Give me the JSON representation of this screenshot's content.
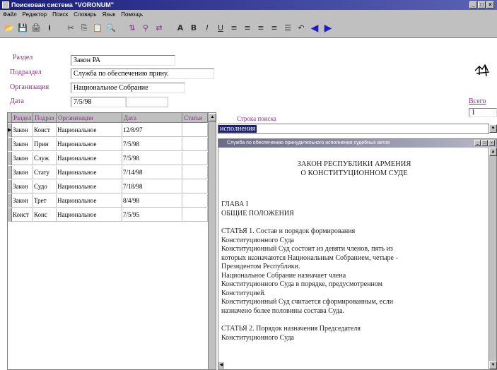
{
  "window": {
    "title": "Поисковая система \"VORONUM\"",
    "controls": [
      "_",
      "□",
      "×"
    ]
  },
  "menu": [
    "Файл",
    "Редактор",
    "Поиск",
    "Словарь",
    "Язык",
    "Помощь"
  ],
  "toolbar": {
    "icons": [
      "open-icon",
      "save-icon",
      "print-icon",
      "info-icon",
      "cut-icon",
      "copy-icon",
      "paste-icon",
      "find-icon",
      "sort-icon",
      "filter-icon",
      "replace-icon",
      "bold-icon",
      "italic-icon",
      "underline-icon",
      "align-left-icon",
      "align-center-icon",
      "align-right-icon",
      "justify-icon",
      "list-icon",
      "undo-icon",
      "prev-icon",
      "next-icon"
    ],
    "glyphs": [
      "📂",
      "💾",
      "🖨",
      "i",
      "✂",
      "⎘",
      "📋",
      "🔍",
      "⇅",
      "⚲",
      "⇄",
      "A",
      "B",
      "I",
      "U",
      "≡",
      "≡",
      "≡",
      "≡",
      "☰",
      "↶",
      "◀",
      "▶"
    ]
  },
  "form": {
    "razdel_label": "Раздел",
    "razdel_value": "Закон РА",
    "podrazdel_label": "Подраздел",
    "podrazdel_value": "Служба по обеспечению прину.",
    "org_label": "Организация",
    "org_value": "Национальное Собрание",
    "date_label": "Дата",
    "date_value": "7/5/98",
    "search_label": "Строка поиска",
    "search_value": "исполнения",
    "total_label": "Всего",
    "total_value": "1"
  },
  "grid": {
    "columns": [
      "Раздел",
      "Подраз",
      "Организация",
      "Дата",
      "Статья"
    ],
    "rows": [
      [
        "Закон",
        "Конст",
        "Национальное",
        "12/8/97",
        ""
      ],
      [
        "Закон",
        "Прин",
        "Национальное",
        "7/5/98",
        ""
      ],
      [
        "Закон",
        "Служ",
        "Национальное",
        "7/5/98",
        ""
      ],
      [
        "Закон",
        "Стату",
        "Национальное",
        "7/14/98",
        ""
      ],
      [
        "Закон",
        "Судо",
        "Национальное",
        "7/18/98",
        ""
      ],
      [
        "Закон",
        "Трет",
        "Национальное",
        "8/4/98",
        ""
      ],
      [
        "Конст",
        "Конс",
        "Национальное",
        "7/5/95",
        ""
      ]
    ]
  },
  "document": {
    "title": "Служба по обеспечению принудительного исполнения судебных актов",
    "heading1": "ЗАКОН РЕСПУБЛИКИ АРМЕНИЯ",
    "heading2": "О КОНСТИТУЦИОННОМ СУДЕ",
    "chapter": "ГЛАВА I",
    "chapter_title": "ОБЩИЕ ПОЛОЖЕНИЯ",
    "article1_title": "СТАТЬЯ 1. Состав и порядок формирования",
    "article1_title2": "Конституционного Суда",
    "article1_lines": [
      "Конституционный Суд состоит из девяти членов, пять из",
      "которых назначаются Национальным Собранием, четыре -",
      "Президентом Республики.",
      "Национальное Собрание назначает члена",
      "Конституционного Суда в порядке, предусмотренном",
      "Конституцией.",
      "Конституционный Суд считается сформированным, если",
      "назначено более половины состава Суда."
    ],
    "article2_title": "СТАТЬЯ 2. Порядок назначения Председателя",
    "article2_title2": "Конституционного Суда"
  },
  "colors": {
    "label": "#8b2c8b",
    "title_bar": "#1a1f7a",
    "selection": "#1a1f7a",
    "chrome": "#c0c0c0"
  }
}
